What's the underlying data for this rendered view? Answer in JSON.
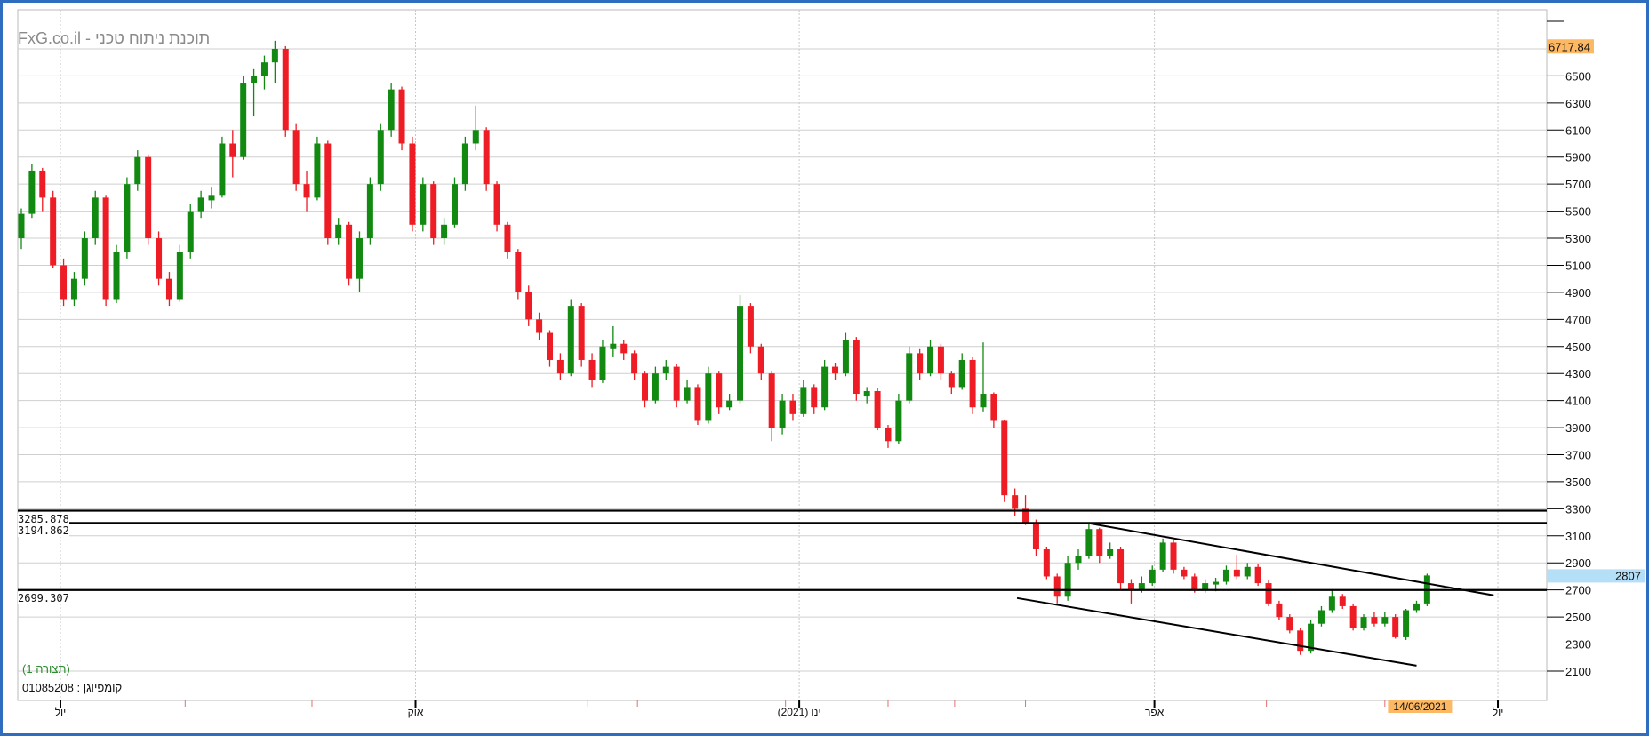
{
  "header": {
    "title": "FxG.co.il - תוכנת ניתוח טכני"
  },
  "footer": {
    "config_label": "(תצורה 1)",
    "symbol_label": "01085208 : קומפיוגן"
  },
  "colors": {
    "up": "#128a12",
    "down": "#ee1c24",
    "grid": "#cfcfcf",
    "frame": "#2f6dbf",
    "highlight_orange": "#fdb863",
    "highlight_blue": "#b5def7"
  },
  "chart_data": {
    "type": "candlestick",
    "title": "FxG.co.il - תוכנת ניתוח טכני",
    "ylim": [
      1883,
      6989
    ],
    "y_ticks": [
      2100,
      2300,
      2500,
      2700,
      2900,
      3100,
      3300,
      3500,
      3700,
      3900,
      4100,
      4300,
      4500,
      4700,
      4900,
      5100,
      5300,
      5500,
      5700,
      5900,
      6100,
      6300,
      6500,
      6700
    ],
    "grid": true,
    "candles_ohlc": [
      [
        5300,
        5520,
        5220,
        5480
      ],
      [
        5480,
        5850,
        5450,
        5800
      ],
      [
        5800,
        5820,
        5500,
        5600
      ],
      [
        5600,
        5650,
        5080,
        5100
      ],
      [
        5100,
        5150,
        4800,
        4850
      ],
      [
        4850,
        5050,
        4800,
        5000
      ],
      [
        5000,
        5350,
        4950,
        5300
      ],
      [
        5300,
        5650,
        5250,
        5600
      ],
      [
        5600,
        5620,
        4800,
        4850
      ],
      [
        4850,
        5250,
        4820,
        5200
      ],
      [
        5200,
        5750,
        5150,
        5700
      ],
      [
        5700,
        5950,
        5650,
        5900
      ],
      [
        5900,
        5920,
        5250,
        5300
      ],
      [
        5300,
        5350,
        4950,
        5000
      ],
      [
        5000,
        5050,
        4800,
        4850
      ],
      [
        4850,
        5250,
        4830,
        5200
      ],
      [
        5200,
        5550,
        5150,
        5500
      ],
      [
        5500,
        5650,
        5450,
        5600
      ],
      [
        5580,
        5680,
        5520,
        5620
      ],
      [
        5620,
        6050,
        5600,
        6000
      ],
      [
        6000,
        6100,
        5750,
        5900
      ],
      [
        5900,
        6500,
        5880,
        6450
      ],
      [
        6450,
        6550,
        6200,
        6500
      ],
      [
        6500,
        6650,
        6400,
        6600
      ],
      [
        6600,
        6760,
        6450,
        6700
      ],
      [
        6700,
        6720,
        6050,
        6100
      ],
      [
        6100,
        6150,
        5650,
        5700
      ],
      [
        5700,
        5800,
        5500,
        5600
      ],
      [
        5600,
        6050,
        5580,
        6000
      ],
      [
        6000,
        6020,
        5250,
        5300
      ],
      [
        5300,
        5450,
        5250,
        5400
      ],
      [
        5400,
        5420,
        4950,
        5000
      ],
      [
        5000,
        5350,
        4900,
        5300
      ],
      [
        5300,
        5750,
        5250,
        5700
      ],
      [
        5700,
        6150,
        5650,
        6100
      ],
      [
        6100,
        6450,
        6050,
        6400
      ],
      [
        6400,
        6420,
        5950,
        6000
      ],
      [
        6000,
        6050,
        5350,
        5400
      ],
      [
        5400,
        5750,
        5350,
        5700
      ],
      [
        5700,
        5720,
        5250,
        5300
      ],
      [
        5300,
        5450,
        5250,
        5400
      ],
      [
        5400,
        5750,
        5380,
        5700
      ],
      [
        5700,
        6050,
        5650,
        6000
      ],
      [
        6000,
        6280,
        5950,
        6100
      ],
      [
        6100,
        6120,
        5650,
        5700
      ],
      [
        5700,
        5720,
        5350,
        5400
      ],
      [
        5400,
        5420,
        5150,
        5200
      ],
      [
        5200,
        5220,
        4850,
        4900
      ],
      [
        4900,
        4950,
        4650,
        4700
      ],
      [
        4700,
        4750,
        4550,
        4600
      ],
      [
        4600,
        4620,
        4350,
        4400
      ],
      [
        4400,
        4450,
        4250,
        4300
      ],
      [
        4300,
        4850,
        4280,
        4800
      ],
      [
        4800,
        4820,
        4350,
        4400
      ],
      [
        4400,
        4450,
        4200,
        4250
      ],
      [
        4250,
        4550,
        4230,
        4500
      ],
      [
        4480,
        4650,
        4420,
        4520
      ],
      [
        4520,
        4550,
        4400,
        4450
      ],
      [
        4450,
        4470,
        4250,
        4300
      ],
      [
        4300,
        4320,
        4050,
        4100
      ],
      [
        4100,
        4350,
        4080,
        4300
      ],
      [
        4300,
        4400,
        4250,
        4350
      ],
      [
        4350,
        4370,
        4050,
        4100
      ],
      [
        4100,
        4250,
        4080,
        4200
      ],
      [
        4200,
        4220,
        3920,
        3950
      ],
      [
        3950,
        4350,
        3930,
        4300
      ],
      [
        4300,
        4320,
        4000,
        4050
      ],
      [
        4050,
        4150,
        4030,
        4100
      ],
      [
        4100,
        4880,
        4080,
        4800
      ],
      [
        4800,
        4820,
        4450,
        4500
      ],
      [
        4500,
        4520,
        4250,
        4300
      ],
      [
        4300,
        4320,
        3800,
        3900
      ],
      [
        3900,
        4150,
        3850,
        4100
      ],
      [
        4100,
        4150,
        3950,
        4000
      ],
      [
        4000,
        4250,
        3980,
        4200
      ],
      [
        4200,
        4220,
        4000,
        4050
      ],
      [
        4050,
        4400,
        4030,
        4350
      ],
      [
        4350,
        4380,
        4250,
        4300
      ],
      [
        4300,
        4600,
        4280,
        4550
      ],
      [
        4550,
        4570,
        4100,
        4150
      ],
      [
        4130,
        4200,
        4080,
        4170
      ],
      [
        4170,
        4190,
        3880,
        3900
      ],
      [
        3900,
        3920,
        3750,
        3800
      ],
      [
        3800,
        4150,
        3780,
        4100
      ],
      [
        4100,
        4500,
        4080,
        4450
      ],
      [
        4450,
        4480,
        4250,
        4300
      ],
      [
        4300,
        4550,
        4280,
        4500
      ],
      [
        4500,
        4520,
        4250,
        4300
      ],
      [
        4300,
        4320,
        4150,
        4200
      ],
      [
        4200,
        4450,
        4180,
        4400
      ],
      [
        4400,
        4420,
        4000,
        4050
      ],
      [
        4050,
        4530,
        4020,
        4150
      ],
      [
        4150,
        4160,
        3900,
        3950
      ],
      [
        3950,
        3960,
        3350,
        3400
      ],
      [
        3400,
        3450,
        3250,
        3300
      ],
      [
        3300,
        3400,
        3180,
        3200
      ],
      [
        3200,
        3220,
        2950,
        3000
      ],
      [
        3000,
        3020,
        2780,
        2800
      ],
      [
        2800,
        2820,
        2600,
        2650
      ],
      [
        2650,
        2950,
        2620,
        2900
      ],
      [
        2900,
        3000,
        2850,
        2950
      ],
      [
        2950,
        3200,
        2930,
        3150
      ],
      [
        3150,
        3160,
        2900,
        2950
      ],
      [
        2950,
        3050,
        2930,
        3000
      ],
      [
        3000,
        3020,
        2700,
        2750
      ],
      [
        2750,
        2780,
        2600,
        2700
      ],
      [
        2700,
        2800,
        2680,
        2750
      ],
      [
        2750,
        2880,
        2730,
        2850
      ],
      [
        2850,
        3080,
        2830,
        3050
      ],
      [
        3050,
        3070,
        2820,
        2850
      ],
      [
        2850,
        2870,
        2780,
        2800
      ],
      [
        2800,
        2820,
        2680,
        2700
      ],
      [
        2700,
        2780,
        2680,
        2750
      ],
      [
        2740,
        2790,
        2690,
        2760
      ],
      [
        2760,
        2880,
        2740,
        2850
      ],
      [
        2850,
        2960,
        2780,
        2800
      ],
      [
        2800,
        2900,
        2780,
        2870
      ],
      [
        2870,
        2890,
        2730,
        2750
      ],
      [
        2750,
        2770,
        2580,
        2600
      ],
      [
        2600,
        2620,
        2480,
        2500
      ],
      [
        2500,
        2520,
        2380,
        2400
      ],
      [
        2400,
        2420,
        2220,
        2250
      ],
      [
        2250,
        2480,
        2230,
        2450
      ],
      [
        2450,
        2580,
        2430,
        2550
      ],
      [
        2550,
        2700,
        2530,
        2650
      ],
      [
        2650,
        2670,
        2560,
        2580
      ],
      [
        2580,
        2600,
        2400,
        2420
      ],
      [
        2420,
        2520,
        2400,
        2500
      ],
      [
        2500,
        2540,
        2430,
        2450
      ],
      [
        2450,
        2540,
        2430,
        2500
      ],
      [
        2500,
        2520,
        2340,
        2350
      ],
      [
        2350,
        2560,
        2330,
        2550
      ],
      [
        2550,
        2620,
        2530,
        2600
      ],
      [
        2600,
        2820,
        2580,
        2807
      ]
    ],
    "horizontal_levels": [
      {
        "value": 3285.878,
        "label": "3285.878"
      },
      {
        "value": 3194.862,
        "label": "3194.862"
      },
      {
        "value": 2699.307,
        "label": "2699.307"
      }
    ],
    "trendlines": [
      {
        "name": "upper-channel",
        "from": [
          101.2,
          3190
        ],
        "to": [
          139.3,
          2660
        ]
      },
      {
        "name": "lower-channel",
        "from": [
          94.2,
          2640
        ],
        "to": [
          132,
          2140
        ]
      }
    ],
    "x_major_ticks": [
      {
        "index": 3.7,
        "label": "יול"
      },
      {
        "index": 37.3,
        "label": "אוק"
      },
      {
        "index": 73.6,
        "label": "ינו (2021)"
      },
      {
        "index": 107.2,
        "label": "אפר"
      },
      {
        "index": 139.7,
        "label": "יול"
      }
    ],
    "x_minor_ticks": [
      15.5,
      27.5,
      53.6,
      58.3,
      72.3,
      82,
      88.3,
      95,
      117.8,
      129
    ],
    "cursor_date": {
      "index": 132.5,
      "label": "14/06/2021"
    },
    "y_markers": [
      {
        "value": 6717.84,
        "label": "6717.84",
        "style": "orange"
      },
      {
        "value": 2807,
        "label": "2807",
        "style": "blue"
      }
    ]
  }
}
